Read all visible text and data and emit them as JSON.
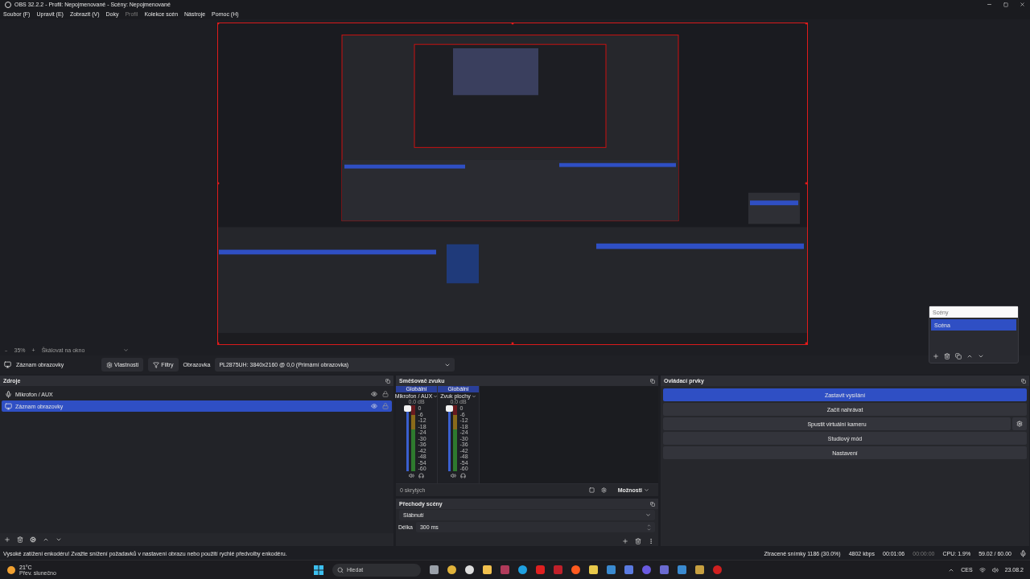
{
  "window": {
    "title": "OBS 32.2.2 - Profil: Nepojmenované - Scény: Nepojmenované"
  },
  "menu": [
    {
      "label": "Soubor (F)",
      "disabled": false
    },
    {
      "label": "Upravit (E)",
      "disabled": false
    },
    {
      "label": "Zobrazit (V)",
      "disabled": false
    },
    {
      "label": "Doky",
      "disabled": false
    },
    {
      "label": "Profil",
      "disabled": true
    },
    {
      "label": "Kolekce scén",
      "disabled": false
    },
    {
      "label": "Nástroje",
      "disabled": false
    },
    {
      "label": "Pomoc (H)",
      "disabled": false
    }
  ],
  "scenes_dock": {
    "title": "Scény",
    "items": [
      {
        "label": "Scéna",
        "selected": true
      }
    ]
  },
  "zoom_bar": {
    "zoom_out": "−",
    "zoom": "35%",
    "zoom_in": "+",
    "scale_mode": "Škálovat na okno"
  },
  "source_toolbar": {
    "source": "Záznam obrazovky",
    "properties": "Vlastnosti",
    "filters": "Filtry",
    "display_label": "Obrazovka",
    "display_value": "PL2875UH: 3840x2160 @ 0,0 (Primární obrazovka)"
  },
  "sources": {
    "title": "Zdroje",
    "items": [
      {
        "name": "Mikrofon / AUX",
        "kind": "mic",
        "selected": false,
        "visible": true
      },
      {
        "name": "Záznam obrazovky",
        "kind": "display",
        "selected": true,
        "visible": true
      }
    ]
  },
  "mixer": {
    "title": "Směšovač zvuku",
    "channels": [
      {
        "badge": "Globální",
        "name": "Mikrofon / AUX",
        "reading": "0.0 dB",
        "level": 1,
        "scale": [
          "0",
          "-6",
          "-12",
          "-18",
          "-24",
          "-30",
          "-36",
          "-42",
          "-48",
          "-54",
          "-60"
        ]
      },
      {
        "badge": "Globální",
        "name": "Zvuk plochy",
        "reading": "0.0 dB",
        "level": 1,
        "scale": [
          "0",
          "-6",
          "-12",
          "-18",
          "-24",
          "-30",
          "-36",
          "-42",
          "-48",
          "-54",
          "-60"
        ]
      }
    ],
    "hidden": "0 skrytých",
    "options": "Možnosti"
  },
  "transitions": {
    "title": "Přechody scény",
    "transition": "Slábnutí",
    "duration_label": "Délka",
    "duration": "300 ms"
  },
  "controls": {
    "title": "Ovládací prvky",
    "buttons": [
      {
        "label": "Zastavit vysílání",
        "active": true,
        "has_settings": false
      },
      {
        "label": "Začít nahrávat",
        "active": false,
        "has_settings": false
      },
      {
        "label": "Spustit virtuální kameru",
        "active": false,
        "has_settings": true
      },
      {
        "label": "Studiový mód",
        "active": false,
        "has_settings": false
      },
      {
        "label": "Nastavení",
        "active": false,
        "has_settings": false
      }
    ]
  },
  "status_bar": {
    "message": "Vysoké zatížení enkodéru! Zvažte snížení požadavků v nastavení obrazu nebo použití rychlé předvolby enkodéru.",
    "dropped_frames": "Ztracené snímky 1186 (30.0%)",
    "bitrate": "4802 kbps",
    "stream_time": "00:01:06",
    "record_time": "00:00:00",
    "cpu": "CPU: 1.9%",
    "fps": "59.02 / 60.00"
  },
  "taskbar": {
    "weather_temp": "21°C",
    "weather_text": "Přev. slunečno",
    "search_placeholder": "Hledat",
    "language": "CES",
    "date": "23.08.2"
  }
}
